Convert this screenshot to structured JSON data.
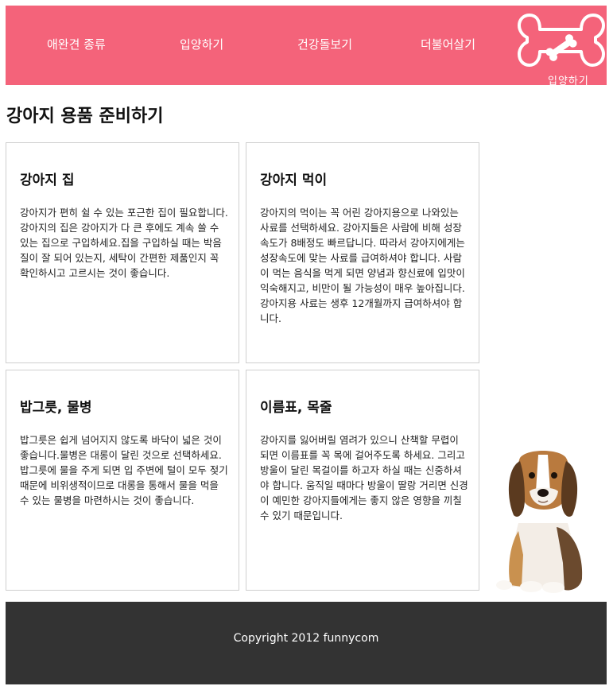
{
  "nav": {
    "items": [
      {
        "label": "애완견 종류"
      },
      {
        "label": "입양하기"
      },
      {
        "label": "건강돌보기"
      },
      {
        "label": "더불어살기"
      }
    ],
    "logo_caption": "입양하기"
  },
  "page_title": "강아지 용품 준비하기",
  "cards": [
    {
      "title": "강아지 집",
      "text": "강아지가 편히 쉴 수 있는 포근한 집이 필요합니다. 강아지의 집은 강아지가 다 큰 후에도 계속 쓸 수 있는 집으로 구입하세요.집을 구입하실 때는 박음질이 잘 되어 있는지, 세탁이 간편한 제품인지 꼭 확인하시고 고르시는 것이 좋습니다."
    },
    {
      "title": "강아지 먹이",
      "text": "강아지의 먹이는 꼭 어린 강아지용으로 나와있는 사료를 선택하세요. 강아지들은 사람에 비해 성장속도가 8배정도 빠르답니다. 따라서 강아지에게는 성장속도에 맞는 사료를 급여하셔야 합니다. 사람이 먹는 음식을 먹게 되면 양념과 향신료에 입맛이 익숙해지고, 비만이 될 가능성이 매우 높아집니다. 강아지용 사료는 생후 12개월까지 급여하셔야 합니다."
    },
    {
      "title": "밥그릇, 물병",
      "text": "밥그릇은 쉽게 넘어지지 않도록 바닥이 넓은 것이 좋습니다.물병은 대롱이 달린 것으로 선택하세요. 밥그릇에 물을 주게 되면 입 주변에 털이 모두 젖기 때문에 비위생적이므로 대롱을 통해서 물을 먹을 수 있는 물병을 마련하시는 것이 좋습니다."
    },
    {
      "title": "이름표, 목줄",
      "text": "강아지를 잃어버릴 염려가 있으니 산책할 무렵이 되면 이름표를 꼭 목에 걸어주도록 하세요. 그리고 방울이 달린 목걸이를 하고자 하실 때는 신중하셔야 합니다. 움직일 때마다 방울이 딸랑 거리면 신경이 예민한 강아지들에게는 좋지 않은 영향을 끼칠 수 있기 때문입니다."
    }
  ],
  "footer": {
    "text": "Copyright 2012 funnycom"
  },
  "colors": {
    "header": "#f4637a",
    "footer": "#333333"
  },
  "icons": {
    "logo": "bone-icon",
    "logo_detail": "small-bone-icon",
    "side_image": "beagle-puppy-image"
  }
}
